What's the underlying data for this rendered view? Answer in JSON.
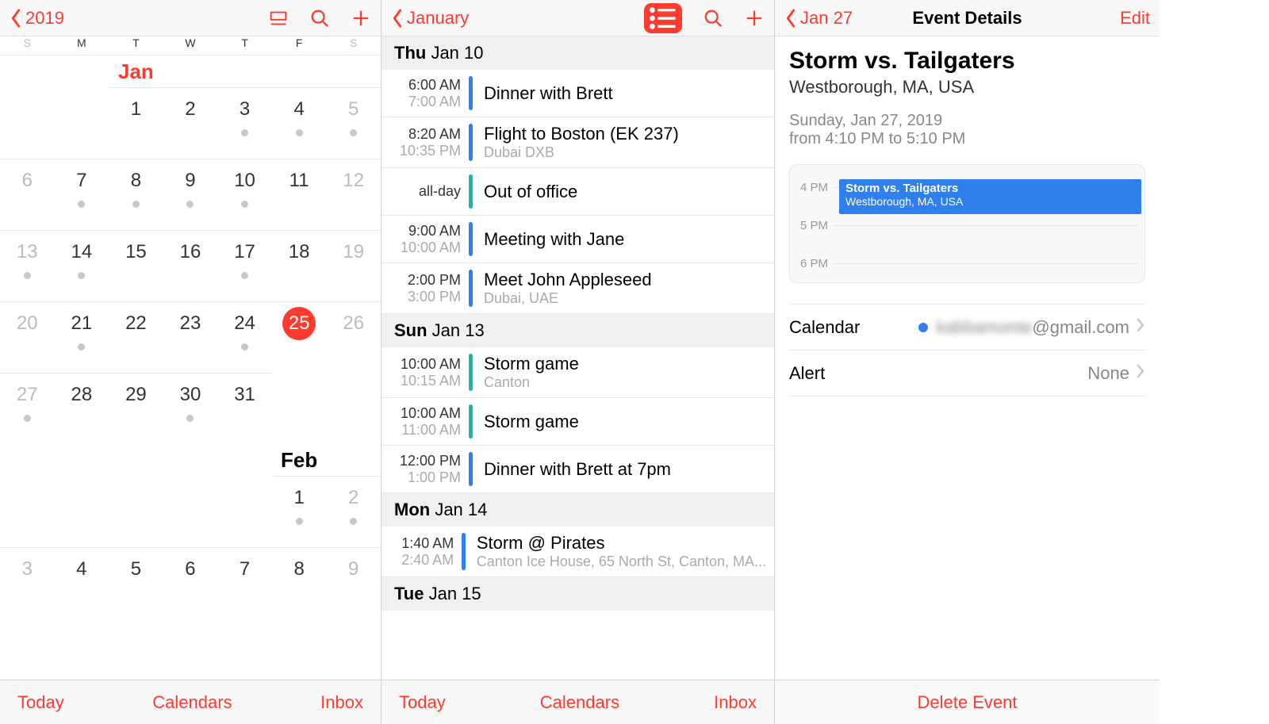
{
  "pane1": {
    "back": "2019",
    "dow": [
      "S",
      "M",
      "T",
      "W",
      "T",
      "F",
      "S"
    ],
    "months": [
      {
        "name": "Jan",
        "labelCol": 2,
        "red": true,
        "weeks": [
          [
            null,
            null,
            {
              "n": 1
            },
            {
              "n": 2
            },
            {
              "n": 3,
              "dot": true
            },
            {
              "n": 4,
              "dot": true
            },
            {
              "n": 5,
              "wknd": true,
              "dot": true
            }
          ],
          [
            {
              "n": 6,
              "wknd": true
            },
            {
              "n": 7,
              "dot": true
            },
            {
              "n": 8,
              "dot": true
            },
            {
              "n": 9,
              "dot": true
            },
            {
              "n": 10,
              "dot": true
            },
            {
              "n": 11
            },
            {
              "n": 12,
              "wknd": true
            }
          ],
          [
            {
              "n": 13,
              "wknd": true,
              "dot": true
            },
            {
              "n": 14,
              "dot": true
            },
            {
              "n": 15
            },
            {
              "n": 16
            },
            {
              "n": 17,
              "dot": true
            },
            {
              "n": 18
            },
            {
              "n": 19,
              "wknd": true
            }
          ],
          [
            {
              "n": 20,
              "wknd": true
            },
            {
              "n": 21,
              "dot": true
            },
            {
              "n": 22
            },
            {
              "n": 23
            },
            {
              "n": 24,
              "dot": true
            },
            {
              "n": 25,
              "today": true
            },
            {
              "n": 26,
              "wknd": true
            }
          ],
          [
            {
              "n": 27,
              "wknd": true,
              "dot": true
            },
            {
              "n": 28
            },
            {
              "n": 29
            },
            {
              "n": 30,
              "dot": true
            },
            {
              "n": 31
            },
            null,
            null
          ]
        ]
      },
      {
        "name": "Feb",
        "labelCol": 5,
        "red": false,
        "weeks": [
          [
            null,
            null,
            null,
            null,
            null,
            {
              "n": 1,
              "dot": true
            },
            {
              "n": 2,
              "wknd": true,
              "dot": true
            }
          ],
          [
            {
              "n": 3,
              "wknd": true
            },
            {
              "n": 4
            },
            {
              "n": 5
            },
            {
              "n": 6
            },
            {
              "n": 7
            },
            {
              "n": 8
            },
            {
              "n": 9,
              "wknd": true
            }
          ]
        ]
      }
    ],
    "tabs": {
      "today": "Today",
      "calendars": "Calendars",
      "inbox": "Inbox"
    }
  },
  "pane2": {
    "back": "January",
    "days": [
      {
        "weekday": "Thu",
        "date": "Jan 10",
        "events": [
          {
            "t1": "6:00 AM",
            "t2": "7:00 AM",
            "color": "blue",
            "title": "Dinner with Brett"
          },
          {
            "t1": "8:20 AM",
            "t2": "10:35 PM",
            "color": "blue",
            "title": "Flight to Boston (EK 237)",
            "loc": "Dubai DXB"
          },
          {
            "allday": "all-day",
            "color": "teal",
            "title": "Out of office"
          },
          {
            "t1": "9:00 AM",
            "t2": "10:00 AM",
            "color": "blue",
            "title": "Meeting with Jane"
          },
          {
            "t1": "2:00 PM",
            "t2": "3:00 PM",
            "color": "blue",
            "title": "Meet John Appleseed",
            "loc": "Dubai, UAE"
          }
        ]
      },
      {
        "weekday": "Sun",
        "date": "Jan 13",
        "events": [
          {
            "t1": "10:00 AM",
            "t2": "10:15 AM",
            "color": "teal",
            "title": "Storm game",
            "loc": "Canton"
          },
          {
            "t1": "10:00 AM",
            "t2": "11:00 AM",
            "color": "teal",
            "title": "Storm game"
          },
          {
            "t1": "12:00 PM",
            "t2": "1:00 PM",
            "color": "blue",
            "title": "Dinner with Brett at 7pm"
          }
        ]
      },
      {
        "weekday": "Mon",
        "date": "Jan 14",
        "events": [
          {
            "t1": "1:40 AM",
            "t2": "2:40 AM",
            "color": "blue",
            "title": "Storm @ Pirates",
            "loc": "Canton Ice House, 65 North St, Canton, MA..."
          }
        ]
      },
      {
        "weekday": "Tue",
        "date": "Jan 15",
        "events": []
      }
    ],
    "tabs": {
      "today": "Today",
      "calendars": "Calendars",
      "inbox": "Inbox"
    }
  },
  "pane3": {
    "back": "Jan 27",
    "title": "Event Details",
    "edit": "Edit",
    "event": {
      "name": "Storm vs. Tailgaters",
      "loc": "Westborough, MA, USA",
      "date": "Sunday, Jan 27, 2019",
      "time": "from 4:10 PM to 5:10 PM"
    },
    "timeline": {
      "labels": [
        "4 PM",
        "5 PM",
        "6 PM"
      ],
      "block": {
        "name": "Storm vs. Tailgaters",
        "loc": "Westborough, MA, USA"
      }
    },
    "rows": {
      "calendar": {
        "label": "Calendar",
        "value_blur": "kabbamonte",
        "value_suffix": "@gmail.com"
      },
      "alert": {
        "label": "Alert",
        "value": "None"
      }
    },
    "delete": "Delete Event"
  }
}
